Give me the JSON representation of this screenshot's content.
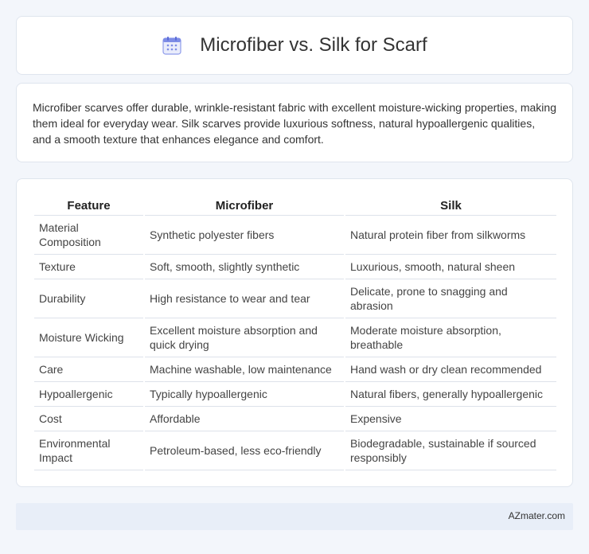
{
  "header": {
    "title": "Microfiber vs. Silk for Scarf",
    "icon": "calendar-icon",
    "icon_color": "#6b7de8"
  },
  "intro": {
    "text": "Microfiber scarves offer durable, wrinkle-resistant fabric with excellent moisture-wicking properties, making them ideal for everyday wear. Silk scarves provide luxurious softness, natural hypoallergenic qualities, and a smooth texture that enhances elegance and comfort."
  },
  "table": {
    "headers": [
      "Feature",
      "Microfiber",
      "Silk"
    ],
    "rows": [
      {
        "feature": "Material Composition",
        "microfiber": "Synthetic polyester fibers",
        "silk": "Natural protein fiber from silkworms"
      },
      {
        "feature": "Texture",
        "microfiber": "Soft, smooth, slightly synthetic",
        "silk": "Luxurious, smooth, natural sheen"
      },
      {
        "feature": "Durability",
        "microfiber": "High resistance to wear and tear",
        "silk": "Delicate, prone to snagging and abrasion"
      },
      {
        "feature": "Moisture Wicking",
        "microfiber": "Excellent moisture absorption and quick drying",
        "silk": "Moderate moisture absorption, breathable"
      },
      {
        "feature": "Care",
        "microfiber": "Machine washable, low maintenance",
        "silk": "Hand wash or dry clean recommended"
      },
      {
        "feature": "Hypoallergenic",
        "microfiber": "Typically hypoallergenic",
        "silk": "Natural fibers, generally hypoallergenic"
      },
      {
        "feature": "Cost",
        "microfiber": "Affordable",
        "silk": "Expensive"
      },
      {
        "feature": "Environmental Impact",
        "microfiber": "Petroleum-based, less eco-friendly",
        "silk": "Biodegradable, sustainable if sourced responsibly"
      }
    ]
  },
  "footer": {
    "site": "AZmater.com"
  }
}
